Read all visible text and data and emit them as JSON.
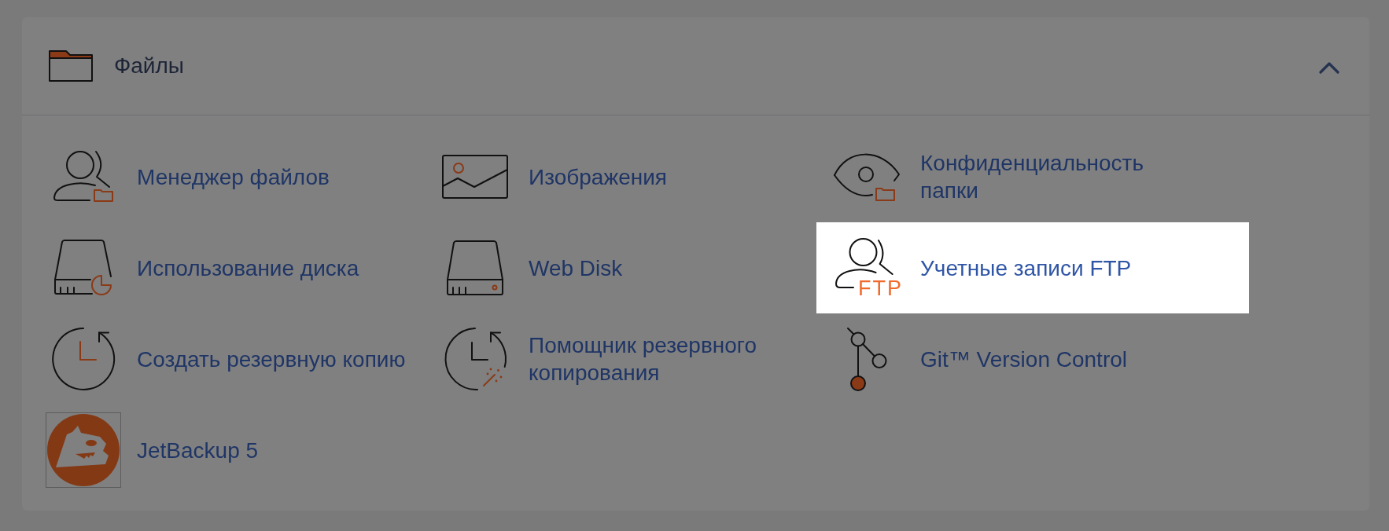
{
  "section": {
    "title": "Файлы",
    "expanded": true,
    "items": [
      {
        "label": "Менеджер файлов",
        "highlighted": false
      },
      {
        "label": "Изображения",
        "highlighted": false
      },
      {
        "label": "Конфиденциальность папки",
        "highlighted": false
      },
      {
        "label": "Использование диска",
        "highlighted": false
      },
      {
        "label": "Web Disk",
        "highlighted": false
      },
      {
        "label": "Учетные записи FTP",
        "icon_label": "FTP",
        "highlighted": true
      },
      {
        "label": "Создать резервную копию",
        "highlighted": false
      },
      {
        "label": "Помощник резервного копирования",
        "highlighted": false
      },
      {
        "label": "Git™ Version Control",
        "highlighted": false
      },
      {
        "label": "JetBackup 5",
        "highlighted": false
      }
    ]
  }
}
